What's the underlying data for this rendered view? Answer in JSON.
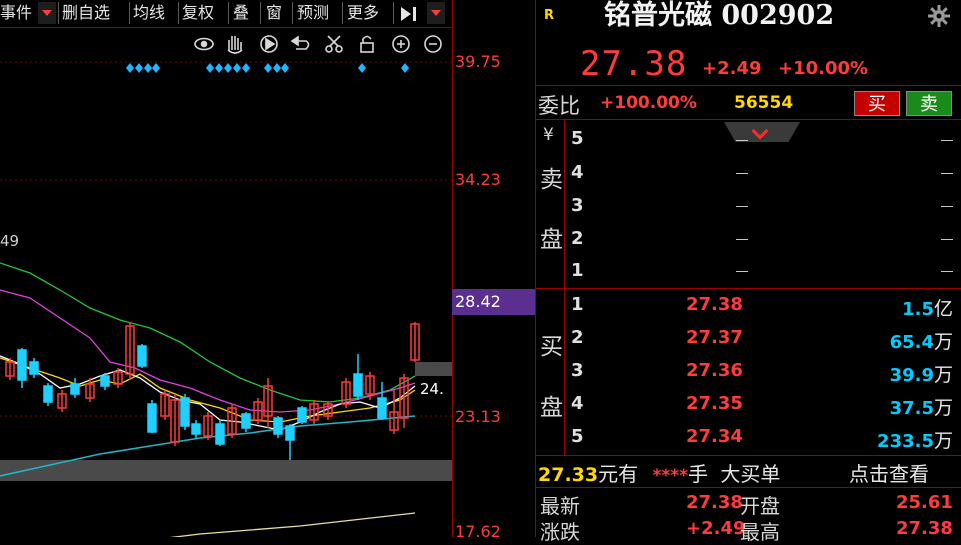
{
  "toolbar": {
    "items": [
      "事件",
      "删自选",
      "均线",
      "复权",
      "叠",
      "窗",
      "预测",
      "更多"
    ]
  },
  "toolbar_icons": [
    "eye-icon",
    "hand-icon",
    "play-icon",
    "undo-icon",
    "scissors-icon",
    "lock-icon",
    "zoom-in-icon",
    "zoom-out-icon"
  ],
  "price_axis": [
    "39.75",
    "34.23",
    "28.42",
    "23.13",
    "17.62"
  ],
  "chart_labels": {
    "ma_label": "49",
    "last_label": "24."
  },
  "stock": {
    "badge": "R",
    "title": "铭普光磁 002902",
    "price": "27.38",
    "change": "+2.49",
    "change_pct": "+10.00%"
  },
  "weibi": {
    "label": "委比",
    "pct": "+100.00%",
    "diff": "56554",
    "buy": "买",
    "sell": "卖"
  },
  "ask": {
    "currency": "¥",
    "label1": "卖",
    "label2": "盘",
    "levels": [
      "5",
      "4",
      "3",
      "2",
      "1"
    ]
  },
  "bid": {
    "label1": "买",
    "label2": "盘",
    "rows": [
      {
        "level": "1",
        "price": "27.38",
        "vol": "1.5",
        "unit": "亿"
      },
      {
        "level": "2",
        "price": "27.37",
        "vol": "65.4",
        "unit": "万"
      },
      {
        "level": "3",
        "price": "27.36",
        "vol": "39.9",
        "unit": "万"
      },
      {
        "level": "4",
        "price": "27.35",
        "vol": "37.5",
        "unit": "万"
      },
      {
        "level": "5",
        "price": "27.34",
        "vol": "233.5",
        "unit": "万"
      }
    ]
  },
  "big_order": {
    "price": "27.33",
    "yuan": "元有",
    "stars": "****",
    "hand": "手",
    "text": "大买单",
    "link": "点击查看"
  },
  "stats": {
    "latest_label": "最新",
    "latest_value": "27.38",
    "open_label": "开盘",
    "open_value": "25.61",
    "change_label": "涨跌",
    "change_value": "+2.49",
    "high_label": "最高",
    "high_value": "27.38"
  },
  "colors": {
    "up": "#ff3b3b",
    "down": "#00ccff",
    "bg": "#000000",
    "grid": "#9a0000"
  }
}
